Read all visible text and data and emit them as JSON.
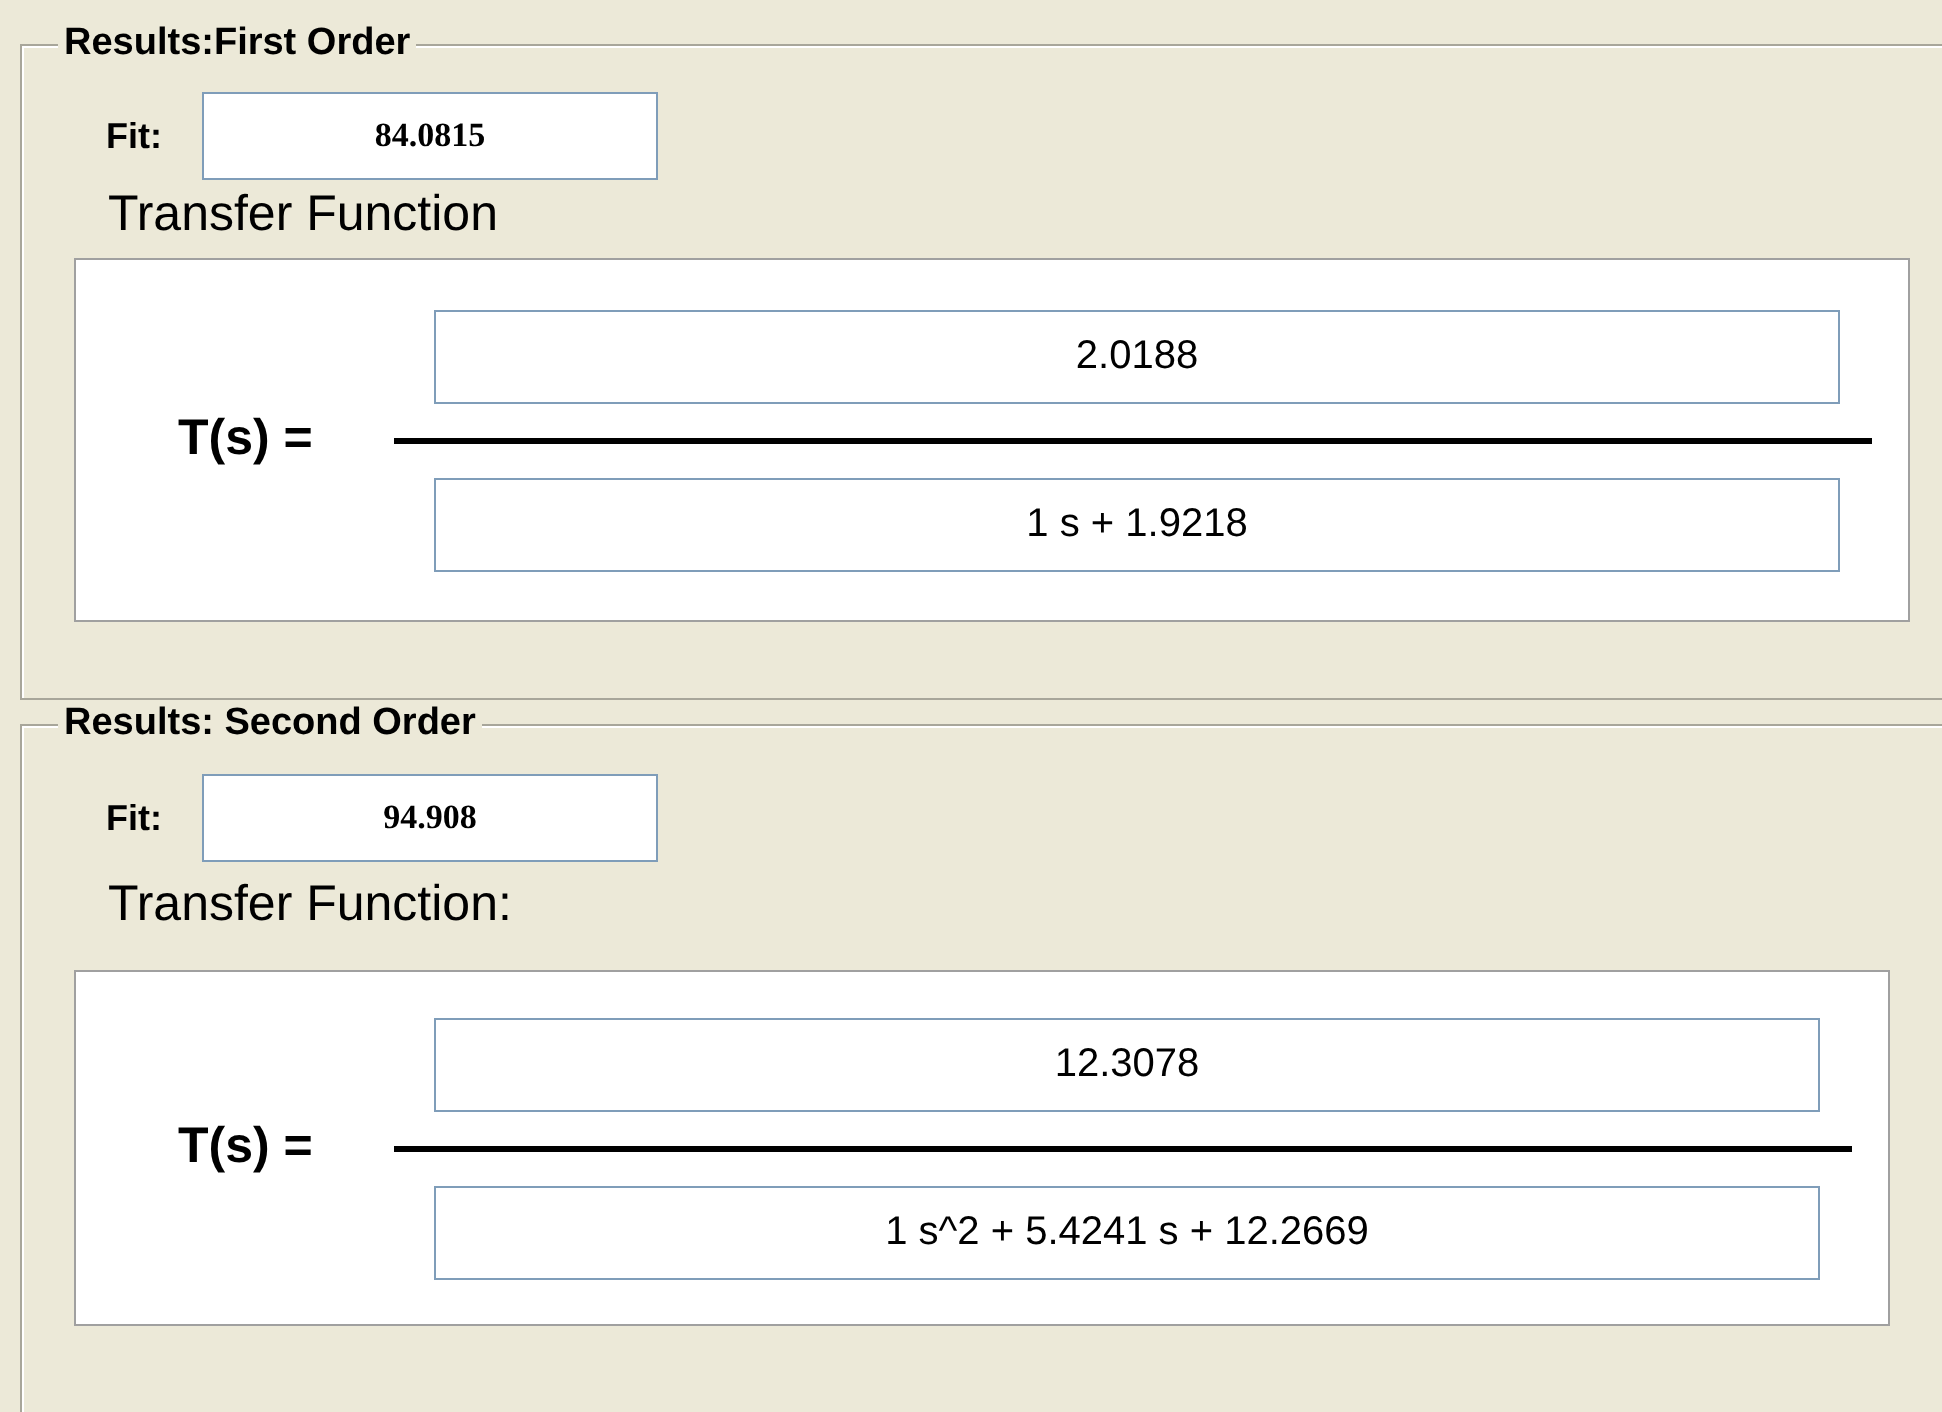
{
  "panels": [
    {
      "title": "Results:First Order",
      "fit_label": "Fit:",
      "fit_value": "84.0815",
      "tf_label": "Transfer Function",
      "lhs": "T(s) =",
      "numerator": "2.0188",
      "denominator": "1 s + 1.9218"
    },
    {
      "title": "Results: Second Order",
      "fit_label": "Fit:",
      "fit_value": "94.908",
      "tf_label": "Transfer Function:",
      "lhs": "T(s) =",
      "numerator": "12.3078",
      "denominator": "1 s^2 + 5.4241 s + 12.2669"
    }
  ]
}
